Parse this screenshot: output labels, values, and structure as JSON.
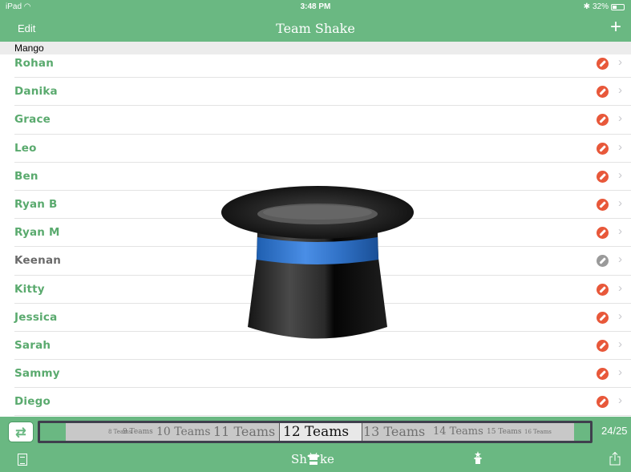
{
  "status_bar": {
    "device": "iPad",
    "time": "3:48 PM",
    "battery": "32%"
  },
  "nav": {
    "edit_label": "Edit",
    "title": "Team Shake",
    "add_label": "+"
  },
  "section": {
    "header": "Mango"
  },
  "players": [
    {
      "name": "Rohan",
      "enabled": true
    },
    {
      "name": "Danika",
      "enabled": true
    },
    {
      "name": "Grace",
      "enabled": true
    },
    {
      "name": "Leo",
      "enabled": true
    },
    {
      "name": "Ben",
      "enabled": true
    },
    {
      "name": "Ryan B",
      "enabled": true
    },
    {
      "name": "Ryan M",
      "enabled": true
    },
    {
      "name": "Keenan",
      "enabled": false
    },
    {
      "name": "Kitty",
      "enabled": true
    },
    {
      "name": "Jessica",
      "enabled": true
    },
    {
      "name": "Sarah",
      "enabled": true
    },
    {
      "name": "Sammy",
      "enabled": true
    },
    {
      "name": "Diego",
      "enabled": true
    }
  ],
  "team_picker": {
    "options": [
      "8 Teams",
      "9 Teams",
      "10 Teams",
      "11 Teams",
      "12 Teams",
      "13 Teams",
      "14 Teams",
      "15 Teams",
      "16 Teams"
    ],
    "selected": "12 Teams",
    "count": "24/25"
  },
  "toolbar": {
    "shake_left": "Sh",
    "shake_right": "ke"
  },
  "colors": {
    "accent": "#6ab882",
    "name_green": "#5aaa6e",
    "block_red": "#e8583a",
    "disabled_gray": "#9a9a9a"
  }
}
